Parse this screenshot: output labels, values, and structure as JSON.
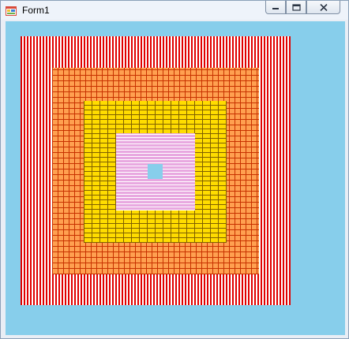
{
  "window": {
    "title": "Form1",
    "controls": {
      "minimize_icon": "minimize-icon",
      "maximize_icon": "maximize-icon",
      "close_icon": "close-icon"
    }
  },
  "canvas": {
    "background_color": "#87ceeb",
    "squares": [
      {
        "name": "outer-red-square",
        "fill": "red",
        "pattern": "vertical-stripes"
      },
      {
        "name": "orange-grid-square",
        "fill": "orange",
        "pattern": "grid"
      },
      {
        "name": "yellow-brick-square",
        "fill": "yellow",
        "pattern": "brick"
      },
      {
        "name": "pink-striped-square",
        "fill": "pink",
        "pattern": "horizontal-stripes"
      },
      {
        "name": "center-blue-square",
        "fill": "#87ceeb",
        "pattern": "solid"
      }
    ]
  }
}
